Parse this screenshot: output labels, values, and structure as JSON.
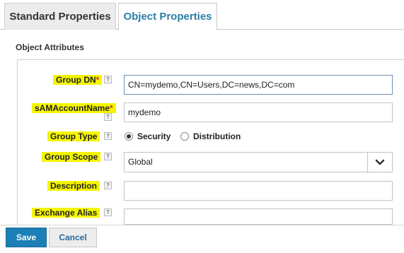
{
  "tabs": [
    {
      "label": "Standard Properties",
      "active": false
    },
    {
      "label": "Object Properties",
      "active": true
    }
  ],
  "section_title": "Object Attributes",
  "help_glyph": "?",
  "required_mark": "*",
  "fields": {
    "group_dn": {
      "label": "Group DN",
      "value": "CN=mydemo,CN=Users,DC=news,DC=com"
    },
    "sam": {
      "label": "sAMAccountName",
      "value": "mydemo"
    },
    "group_type": {
      "label": "Group Type",
      "options": [
        "Security",
        "Distribution"
      ],
      "selected": "Security"
    },
    "group_scope": {
      "label": "Group Scope",
      "value": "Global"
    },
    "description": {
      "label": "Description",
      "value": ""
    },
    "exchange_alias": {
      "label": "Exchange Alias",
      "value": ""
    }
  },
  "buttons": {
    "save": "Save",
    "cancel": "Cancel"
  },
  "colors": {
    "accent": "#1c7fb5",
    "highlight": "#f5f500",
    "required": "#c0392b",
    "tab_active_text": "#2a7ea6"
  },
  "icons": {
    "dropdown": "chevron-down-icon",
    "help": "help-icon"
  }
}
